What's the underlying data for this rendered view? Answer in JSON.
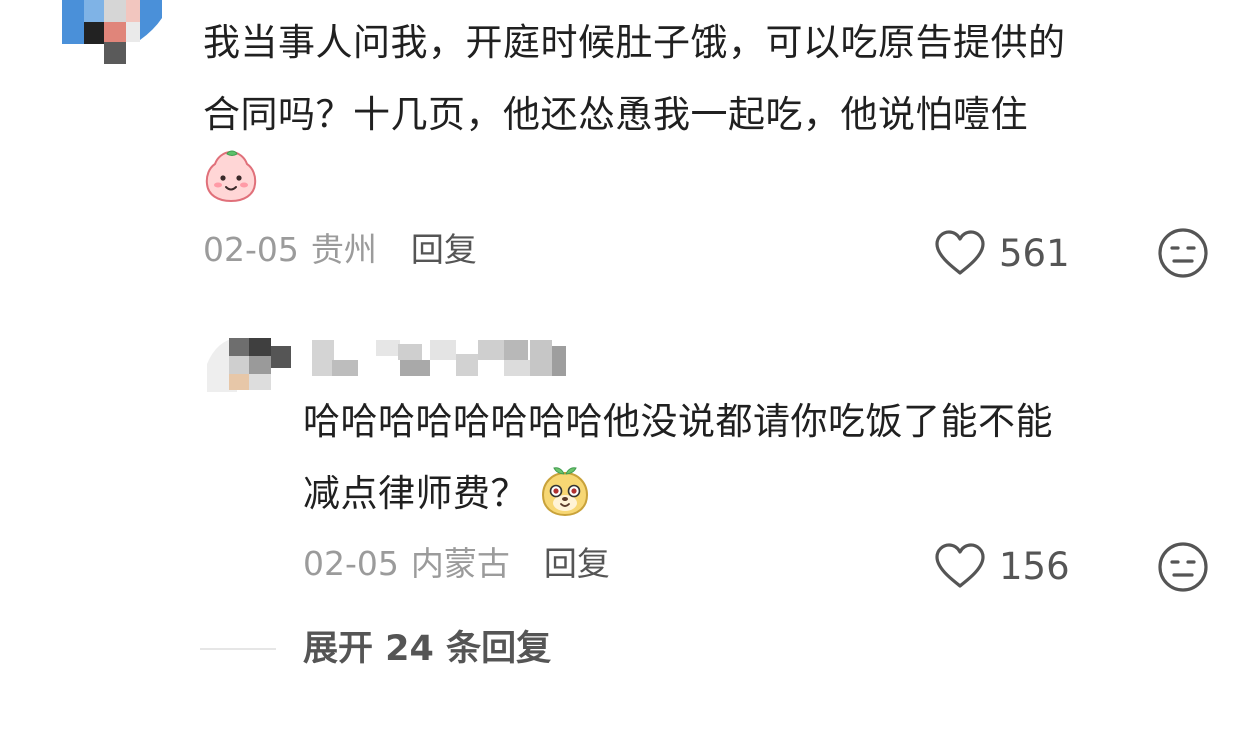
{
  "main_comment": {
    "text_line1": "我当事人问我，开庭时候肚子饿，可以吃原告提供的",
    "text_line2": "合同吗？十几页，他还怂恿我一起吃，他说怕噎住",
    "emoji_icon": "peach-smile-emoji",
    "date": "02-05",
    "location": "贵州",
    "reply_label": "回复",
    "likes": "561",
    "dislike_icon": "meh-face-icon"
  },
  "reply_comment": {
    "text_line1": "哈哈哈哈哈哈哈哈他没说都请你吃饭了能不能",
    "text_line2": "减点律师费？",
    "emoji_icon": "sprout-doge-emoji",
    "date": "02-05",
    "location": "内蒙古",
    "reply_label": "回复",
    "likes": "156",
    "dislike_icon": "meh-face-icon"
  },
  "expand": {
    "label": "展开 24 条回复"
  },
  "colors": {
    "text": "#202020",
    "meta_gray": "#9b9b9b",
    "action_gray": "#555555",
    "avatar_blue": "#4a90d9"
  }
}
